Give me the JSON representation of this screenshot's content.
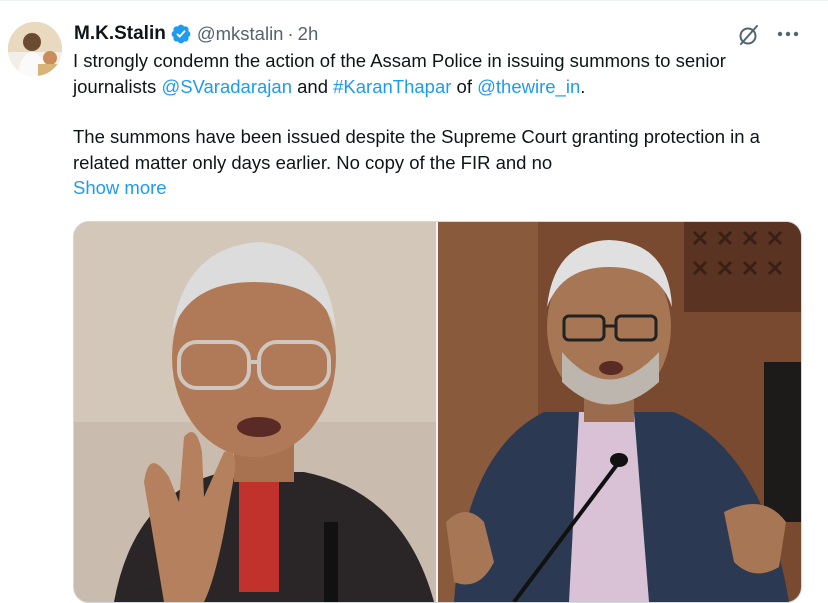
{
  "author": {
    "name": "M.K.Stalin",
    "handle": "@mkstalin",
    "separator": "·",
    "time": "2h",
    "verified_color": "#1d9bf0"
  },
  "tweet": {
    "p1_text1": "I strongly condemn the action of the Assam Police in issuing summons to senior journalists ",
    "p1_mention1": "@SVaradarajan",
    "p1_text2": " and ",
    "p1_hashtag": "#KaranThapar",
    "p1_text3": " of ",
    "p1_mention2": "@thewire_in",
    "p1_text4": ".",
    "p2_text": "The summons have been issued despite the Supreme Court granting protection in a related matter only days earlier. No copy of the FIR and no",
    "show_more": "Show more"
  },
  "icons": {
    "grok": "grok-icon",
    "more": "more-icon",
    "verified": "verified-badge-icon"
  },
  "colors": {
    "link": "#1d9bf0",
    "text": "#0f1419",
    "muted": "#536471"
  }
}
